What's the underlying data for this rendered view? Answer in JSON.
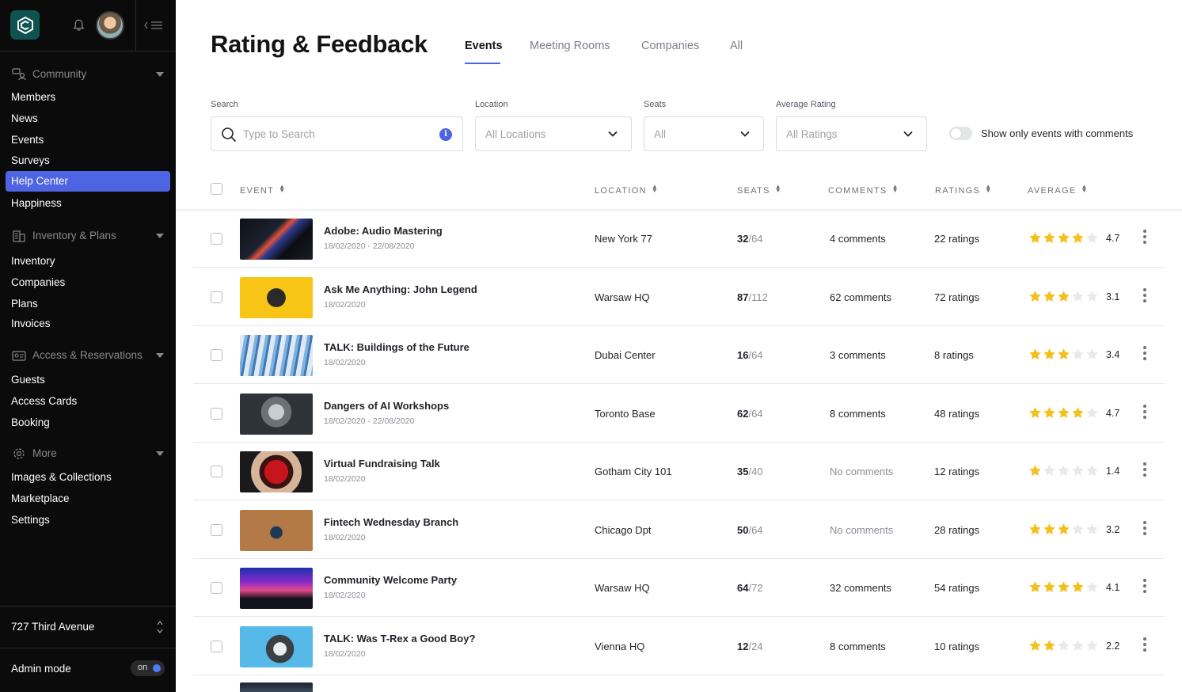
{
  "sidebar": {
    "sections": [
      {
        "label": "Community",
        "icon": "community-icon",
        "items": [
          "Members",
          "News",
          "Events",
          "Surveys",
          "Help Center",
          "Happiness"
        ]
      },
      {
        "label": "Inventory & Plans",
        "icon": "building-icon",
        "items": [
          "Inventory",
          "Companies",
          "Plans",
          "Invoices"
        ]
      },
      {
        "label": "Access & Reservations",
        "icon": "id-card-icon",
        "items": [
          "Guests",
          "Access Cards",
          "Booking"
        ]
      },
      {
        "label": "More",
        "icon": "gear-icon",
        "items": [
          "Images & Collections",
          "Marketplace",
          "Settings"
        ]
      }
    ],
    "active_item": "Help Center",
    "location": "727 Third Avenue",
    "admin_mode_label": "Admin mode",
    "admin_toggle": "on"
  },
  "header": {
    "title": "Rating & Feedback",
    "tabs": [
      "Events",
      "Meeting Rooms",
      "Companies",
      "All"
    ],
    "active_tab": "Events"
  },
  "filters": {
    "search_label": "Search",
    "search_placeholder": "Type to Search",
    "location_label": "Location",
    "location_value": "All Locations",
    "seats_label": "Seats",
    "seats_value": "All",
    "rating_label": "Average Rating",
    "rating_value": "All Ratings",
    "comments_toggle_label": "Show only events with comments",
    "comments_toggle_on": false
  },
  "table": {
    "columns": [
      "EVENT",
      "LOCATION",
      "SEATS",
      "COMMENTS",
      "RATINGS",
      "AVERAGE"
    ],
    "rows": [
      {
        "title": "Adobe: Audio Mastering",
        "date": "18/02/2020 - 22/08/2020",
        "location": "New York 77",
        "seats_taken": "32",
        "seats_total": "/64",
        "comments": "4 comments",
        "ratings": "22 ratings",
        "stars": 4,
        "average": "4.7",
        "thumb": "mixer"
      },
      {
        "title": "Ask Me Anything: John Legend",
        "date": "18/02/2020",
        "location": "Warsaw HQ",
        "seats_taken": "87",
        "seats_total": "/112",
        "comments": "62 comments",
        "ratings": "72 ratings",
        "stars": 3,
        "average": "3.1",
        "thumb": "headphones"
      },
      {
        "title": "TALK: Buildings of the Future",
        "date": "18/02/2020",
        "location": "Dubai Center",
        "seats_taken": "16",
        "seats_total": "/64",
        "comments": "3 comments",
        "ratings": "8 ratings",
        "stars": 3,
        "average": "3.4",
        "thumb": "building"
      },
      {
        "title": "Dangers of AI Workshops",
        "date": "18/02/2020 - 22/08/2020",
        "location": "Toronto Base",
        "seats_taken": "62",
        "seats_total": "/64",
        "comments": "8 comments",
        "ratings": "48 ratings",
        "stars": 4,
        "average": "4.7",
        "thumb": "robot"
      },
      {
        "title": "Virtual Fundraising Talk",
        "date": "18/02/2020",
        "location": "Gotham City 101",
        "seats_taken": "35",
        "seats_total": "/40",
        "comments": "No comments",
        "ratings": "12 ratings",
        "stars": 1,
        "average": "1.4",
        "thumb": "heart"
      },
      {
        "title": "Fintech Wednesday Branch",
        "date": "18/02/2020",
        "location": "Chicago Dpt",
        "seats_taken": "50",
        "seats_total": "/64",
        "comments": "No comments",
        "ratings": "28 ratings",
        "stars": 3,
        "average": "3.2",
        "thumb": "desk"
      },
      {
        "title": "Community Welcome Party",
        "date": "18/02/2020",
        "location": "Warsaw HQ",
        "seats_taken": "64",
        "seats_total": "/72",
        "comments": "32 comments",
        "ratings": "54 ratings",
        "stars": 4,
        "average": "4.1",
        "thumb": "concert"
      },
      {
        "title": "TALK: Was T-Rex a Good Boy?",
        "date": "18/02/2020",
        "location": "Vienna HQ",
        "seats_taken": "12",
        "seats_total": "/24",
        "comments": "8 comments",
        "ratings": "10 ratings",
        "stars": 2,
        "average": "2.2",
        "thumb": "trex"
      }
    ]
  },
  "colors": {
    "accent": "#4e64e2",
    "sidebar_bg": "#0b0b0b",
    "star_filled": "#f3c01c",
    "star_empty": "#e7e9ec",
    "logo_bg": "#0f5350"
  }
}
